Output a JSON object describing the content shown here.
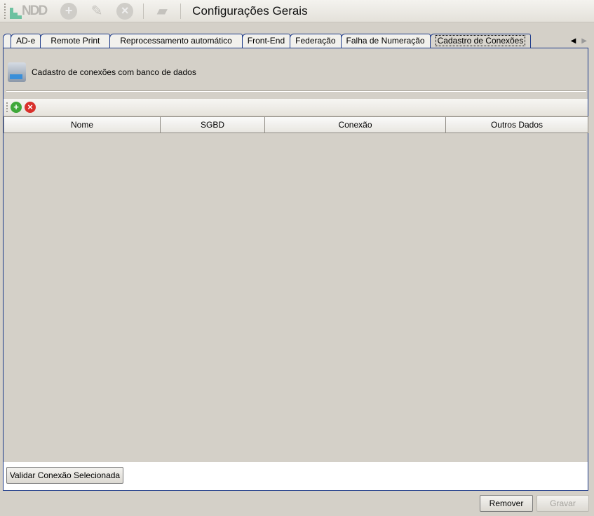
{
  "toolbar": {
    "title": "Configurações Gerais",
    "logo_text": "NDD"
  },
  "tabs": [
    "AD-e",
    "Remote Print",
    "Reprocessamento automático",
    "Front-End",
    "Federação",
    "Falha de Numeração",
    "Cadastro de Conexões"
  ],
  "panel": {
    "header": "Cadastro de conexões com banco de dados",
    "columns": [
      "Nome",
      "SGBD",
      "Conexão",
      "Outros Dados"
    ],
    "validate_button": "Validar Conexão Selecionada"
  },
  "footer": {
    "remove": "Remover",
    "save": "Gravar"
  }
}
